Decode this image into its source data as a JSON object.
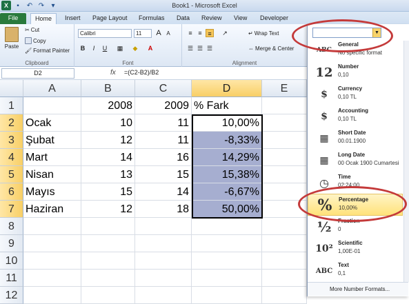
{
  "title": "Book1 - Microsoft Excel",
  "tabs": [
    "File",
    "Home",
    "Insert",
    "Page Layout",
    "Formulas",
    "Data",
    "Review",
    "View",
    "Developer"
  ],
  "ribbon": {
    "paste": "Paste",
    "cut": "Cut",
    "copy": "Copy",
    "format_painter": "Format Painter",
    "clipboard_label": "Clipboard",
    "font_name": "Calibri",
    "font_size": "11",
    "bold": "B",
    "italic": "I",
    "underline": "U",
    "font_label": "Font",
    "wrap_text": "Wrap Text",
    "merge_center": "Merge & Center",
    "alignment_label": "Alignment",
    "font_color_letter": "A",
    "font_size_up": "A",
    "font_size_down": "A"
  },
  "formula_bar": {
    "cell": "D2",
    "fx": "fx",
    "formula": "=(C2-B2)/B2"
  },
  "columns": [
    "A",
    "B",
    "C",
    "D",
    "E"
  ],
  "rows": [
    {
      "n": "1",
      "a": "",
      "b": "2008",
      "c": "2009",
      "d": "% Fark"
    },
    {
      "n": "2",
      "a": "Ocak",
      "b": "10",
      "c": "11",
      "d": "10,00%"
    },
    {
      "n": "3",
      "a": "Şubat",
      "b": "12",
      "c": "11",
      "d": "-8,33%"
    },
    {
      "n": "4",
      "a": "Mart",
      "b": "14",
      "c": "16",
      "d": "14,29%"
    },
    {
      "n": "5",
      "a": "Nisan",
      "b": "13",
      "c": "15",
      "d": "15,38%"
    },
    {
      "n": "6",
      "a": "Mayıs",
      "b": "15",
      "c": "14",
      "d": "-6,67%"
    },
    {
      "n": "7",
      "a": "Haziran",
      "b": "12",
      "c": "18",
      "d": "50,00%"
    },
    {
      "n": "8",
      "a": "",
      "b": "",
      "c": "",
      "d": ""
    },
    {
      "n": "9",
      "a": "",
      "b": "",
      "c": "",
      "d": ""
    },
    {
      "n": "10",
      "a": "",
      "b": "",
      "c": "",
      "d": ""
    },
    {
      "n": "11",
      "a": "",
      "b": "",
      "c": "",
      "d": ""
    },
    {
      "n": "12",
      "a": "",
      "b": "",
      "c": "",
      "d": ""
    }
  ],
  "number_formats": [
    {
      "icon": "ABC",
      "name": "General",
      "sample": "No specific format"
    },
    {
      "icon": "12",
      "name": "Number",
      "sample": "0,10"
    },
    {
      "icon": "$",
      "name": "Currency",
      "sample": "0,10 TL"
    },
    {
      "icon": "$",
      "name": "Accounting",
      "sample": " 0,10 TL"
    },
    {
      "icon": "▦",
      "name": "Short Date",
      "sample": "00.01.1900"
    },
    {
      "icon": "▦",
      "name": "Long Date",
      "sample": "00 Ocak 1900 Cumartesi"
    },
    {
      "icon": "◷",
      "name": "Time",
      "sample": "02:24:00"
    },
    {
      "icon": "%",
      "name": "Percentage",
      "sample": "10,00%"
    },
    {
      "icon": "½",
      "name": "Fraction",
      "sample": "0"
    },
    {
      "icon": "10²",
      "name": "Scientific",
      "sample": "1,00E-01"
    },
    {
      "icon": "ABC",
      "name": "Text",
      "sample": "0,1"
    }
  ],
  "more_formats": "More Number Formats...",
  "colors": {
    "accent": "#2a7a3c",
    "selection": "#a6aed0",
    "highlight": "#ffe27a",
    "annotation": "#c43a3a"
  }
}
